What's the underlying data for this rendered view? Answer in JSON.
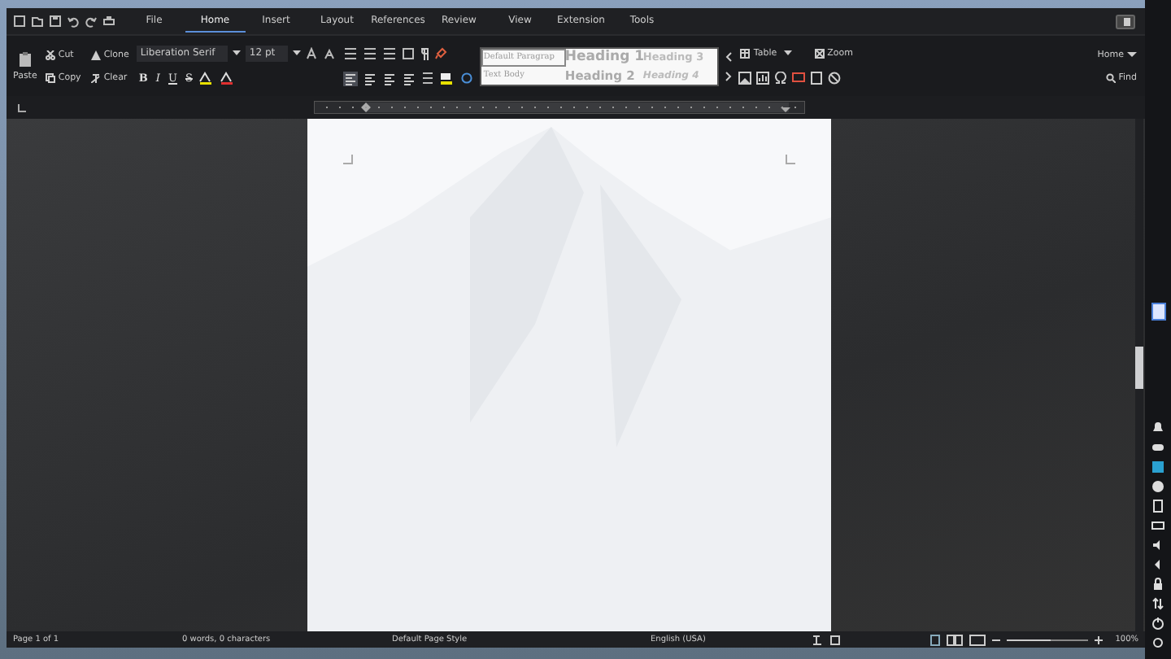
{
  "tabs": [
    {
      "label": "File",
      "selected": false
    },
    {
      "label": "Home",
      "selected": true
    },
    {
      "label": "Insert",
      "selected": false
    },
    {
      "label": "Layout",
      "selected": false
    },
    {
      "label": "References",
      "selected": false
    },
    {
      "label": "Review",
      "selected": false
    },
    {
      "label": "View",
      "selected": false
    },
    {
      "label": "Extension",
      "selected": false
    },
    {
      "label": "Tools",
      "selected": false
    }
  ],
  "clipboard": {
    "paste": "Paste",
    "cut": "Cut",
    "copy": "Copy",
    "clone": "Clone",
    "clear": "Clear"
  },
  "font": {
    "name": "Liberation Serif",
    "size": "12 pt"
  },
  "format_letters": [
    "B",
    "I",
    "U",
    "S"
  ],
  "align": [
    {
      "selected": true
    },
    {
      "selected": false
    },
    {
      "selected": false
    },
    {
      "selected": false
    }
  ],
  "styles": [
    {
      "label": "Default Paragrap",
      "kind": "default",
      "selected": true
    },
    {
      "label": "Heading 1",
      "kind": "h1",
      "selected": false
    },
    {
      "label": "Heading 3",
      "kind": "h3",
      "selected": false
    },
    {
      "label": "Text Body",
      "kind": "body",
      "selected": false
    },
    {
      "label": "Heading 2",
      "kind": "h2",
      "selected": false
    },
    {
      "label": "Heading 4",
      "kind": "h4",
      "selected": false
    }
  ],
  "insert": {
    "table": "Table",
    "zoom": "Zoom"
  },
  "right": {
    "mode": "Home",
    "find": "Find"
  },
  "status_bar": {
    "page": "Page 1 of 1",
    "words": "0 words, 0 characters",
    "page_style": "Default Page Style",
    "language": "English (USA)",
    "zoom_slider": {
      "level": 0.55
    },
    "zoom": "100%"
  }
}
